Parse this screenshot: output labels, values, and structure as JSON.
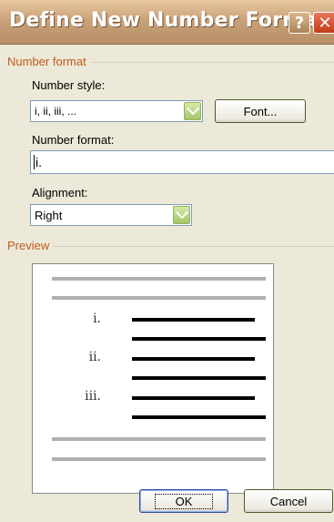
{
  "dialog": {
    "title": "Define New Number Format",
    "help_button": "?",
    "close_button": "✕"
  },
  "number_format_group": {
    "label": "Number format",
    "number_style_label": "Number style:",
    "number_style_value": "i, ii, iii, ...",
    "font_button": "Font...",
    "number_format_label": "Number format:",
    "number_format_value": "i.",
    "alignment_label": "Alignment:",
    "alignment_value": "Right"
  },
  "preview_group": {
    "label": "Preview",
    "numbers": [
      "i.",
      "ii.",
      "iii."
    ]
  },
  "footer": {
    "ok_button": "OK",
    "cancel_button": "Cancel"
  }
}
